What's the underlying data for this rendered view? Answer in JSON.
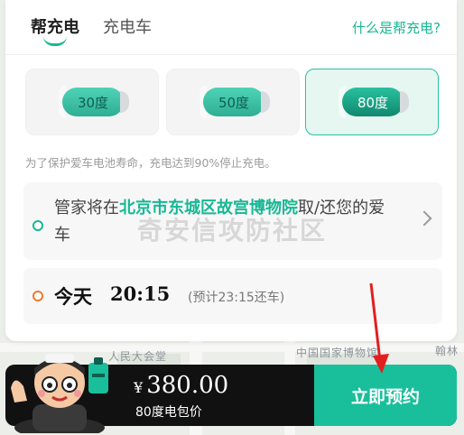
{
  "tabs": {
    "active": "帮充电",
    "inactive": "充电车"
  },
  "help_link": "什么是帮充电?",
  "options": [
    {
      "label": "30度",
      "selected": false
    },
    {
      "label": "50度",
      "selected": false
    },
    {
      "label": "80度",
      "selected": true
    }
  ],
  "note": "为了保护爱车电池寿命，充电达到90%停止充电。",
  "location": {
    "prefix": "管家将在",
    "highlight": "北京市东城区故宫博物院",
    "suffix": "取/还您的爱车"
  },
  "time": {
    "day": "今天",
    "clock": "20:15",
    "return_note": "(预计23:15还车)"
  },
  "bottom": {
    "currency": "¥",
    "price": "380.00",
    "package": "80度电包价",
    "reserve_label": "立即预约"
  },
  "map_labels": {
    "a": "人民大会堂",
    "b": "中国国家博物馆",
    "c": "翰林"
  },
  "watermark": "奇安信攻防社区",
  "colors": {
    "accent": "#17b894",
    "orange": "#f27a2a",
    "bar": "#111111"
  }
}
